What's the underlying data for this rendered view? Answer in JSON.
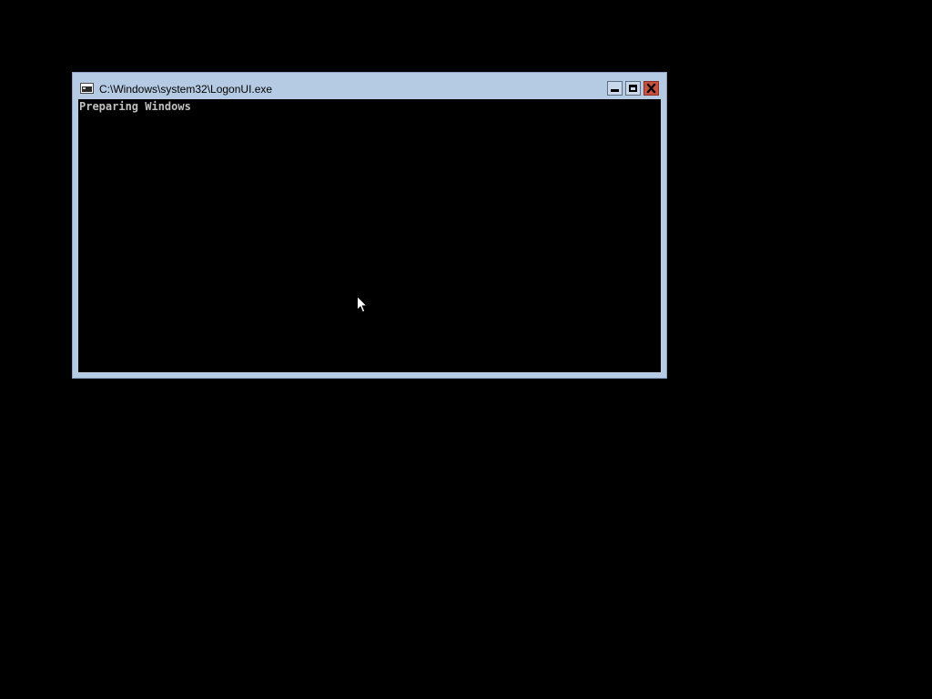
{
  "window": {
    "title": "C:\\Windows\\system32\\LogonUI.exe",
    "icon": "console-app-icon",
    "buttons": {
      "minimize": "minimize-icon",
      "maximize": "maximize-icon",
      "close": "close-icon"
    }
  },
  "console": {
    "lines": [
      "Preparing Windows"
    ]
  },
  "colors": {
    "desktop": "#000000",
    "frame": "#b5cbe3",
    "console_bg": "#000000",
    "console_text": "#c0c0c0",
    "close_button": "#c7503f"
  },
  "cursor": "arrow-cursor-icon"
}
